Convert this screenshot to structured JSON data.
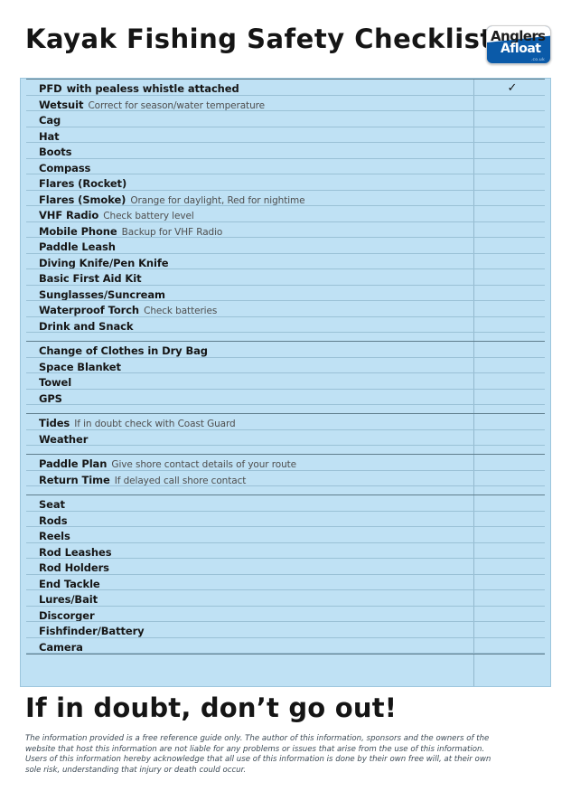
{
  "header": {
    "title": "Kayak Fishing Safety Checklist",
    "logo": {
      "line1": "Anglers",
      "line2": "Afloat",
      "domain": ".co.uk"
    }
  },
  "checklist": {
    "check_column_header": "✓",
    "groups": [
      {
        "items": [
          {
            "label": "PFD",
            "desc": "with pealess whistle attached",
            "desc_bold": true
          },
          {
            "label": "Wetsuit",
            "desc": "Correct for season/water temperature",
            "desc_bold": false
          },
          {
            "label": "Cag",
            "desc": "",
            "desc_bold": false
          },
          {
            "label": "Hat",
            "desc": "",
            "desc_bold": false
          },
          {
            "label": "Boots",
            "desc": "",
            "desc_bold": false
          },
          {
            "label": "Compass",
            "desc": "",
            "desc_bold": false
          },
          {
            "label": "Flares (Rocket)",
            "desc": "",
            "desc_bold": false
          },
          {
            "label": "Flares (Smoke)",
            "desc": "Orange for daylight, Red for nightime",
            "desc_bold": false
          },
          {
            "label": "VHF Radio",
            "desc": "Check battery level",
            "desc_bold": false
          },
          {
            "label": "Mobile Phone",
            "desc": "Backup for VHF Radio",
            "desc_bold": false
          },
          {
            "label": "Paddle Leash",
            "desc": "",
            "desc_bold": false
          },
          {
            "label": "Diving Knife/Pen Knife",
            "desc": "",
            "desc_bold": false
          },
          {
            "label": "Basic First Aid Kit",
            "desc": "",
            "desc_bold": false
          },
          {
            "label": "Sunglasses/Suncream",
            "desc": "",
            "desc_bold": false
          },
          {
            "label": "Waterproof Torch",
            "desc": "Check batteries",
            "desc_bold": false
          },
          {
            "label": "Drink and Snack",
            "desc": "",
            "desc_bold": false
          }
        ]
      },
      {
        "items": [
          {
            "label": "Change of Clothes in Dry Bag",
            "desc": "",
            "desc_bold": false
          },
          {
            "label": "Space Blanket",
            "desc": "",
            "desc_bold": false
          },
          {
            "label": "Towel",
            "desc": "",
            "desc_bold": false
          },
          {
            "label": "GPS",
            "desc": "",
            "desc_bold": false
          }
        ]
      },
      {
        "items": [
          {
            "label": "Tides",
            "desc": "If in doubt check with Coast Guard",
            "desc_bold": false
          },
          {
            "label": "Weather",
            "desc": "",
            "desc_bold": false
          }
        ]
      },
      {
        "items": [
          {
            "label": "Paddle Plan",
            "desc": "Give shore contact details of your route",
            "desc_bold": false
          },
          {
            "label": "Return Time",
            "desc": "If delayed call shore contact",
            "desc_bold": false
          }
        ]
      },
      {
        "items": [
          {
            "label": "Seat",
            "desc": "",
            "desc_bold": false
          },
          {
            "label": "Rods",
            "desc": "",
            "desc_bold": false
          },
          {
            "label": "Reels",
            "desc": "",
            "desc_bold": false
          },
          {
            "label": "Rod Leashes",
            "desc": "",
            "desc_bold": false
          },
          {
            "label": "Rod Holders",
            "desc": "",
            "desc_bold": false
          },
          {
            "label": "End Tackle",
            "desc": "",
            "desc_bold": false
          },
          {
            "label": "Lures/Bait",
            "desc": "",
            "desc_bold": false
          },
          {
            "label": "Discorger",
            "desc": "",
            "desc_bold": false
          },
          {
            "label": "Fishfinder/Battery",
            "desc": "",
            "desc_bold": false
          },
          {
            "label": "Camera",
            "desc": "",
            "desc_bold": false
          }
        ]
      }
    ]
  },
  "slogan": "If in doubt, don’t go out!",
  "disclaimer": {
    "line1": "The information provided is a free reference guide only. The author of this information, sponsors and the owners of the",
    "line2": "website that host this information are not liable for any problems or issues that arise from the use of this information.",
    "line3": "Users of this information hereby acknowledge that all use of this information is done by their own free will, at their own",
    "line4": "sole risk, understanding that injury or death could occur."
  },
  "colors": {
    "panel_bg": "#bfe1f4",
    "row_rule": "#9ac1d6",
    "group_rule": "#5f7d8c",
    "logo_blue": "#0b5aa8",
    "text": "#161616",
    "desc_text": "#4e4e4e"
  }
}
